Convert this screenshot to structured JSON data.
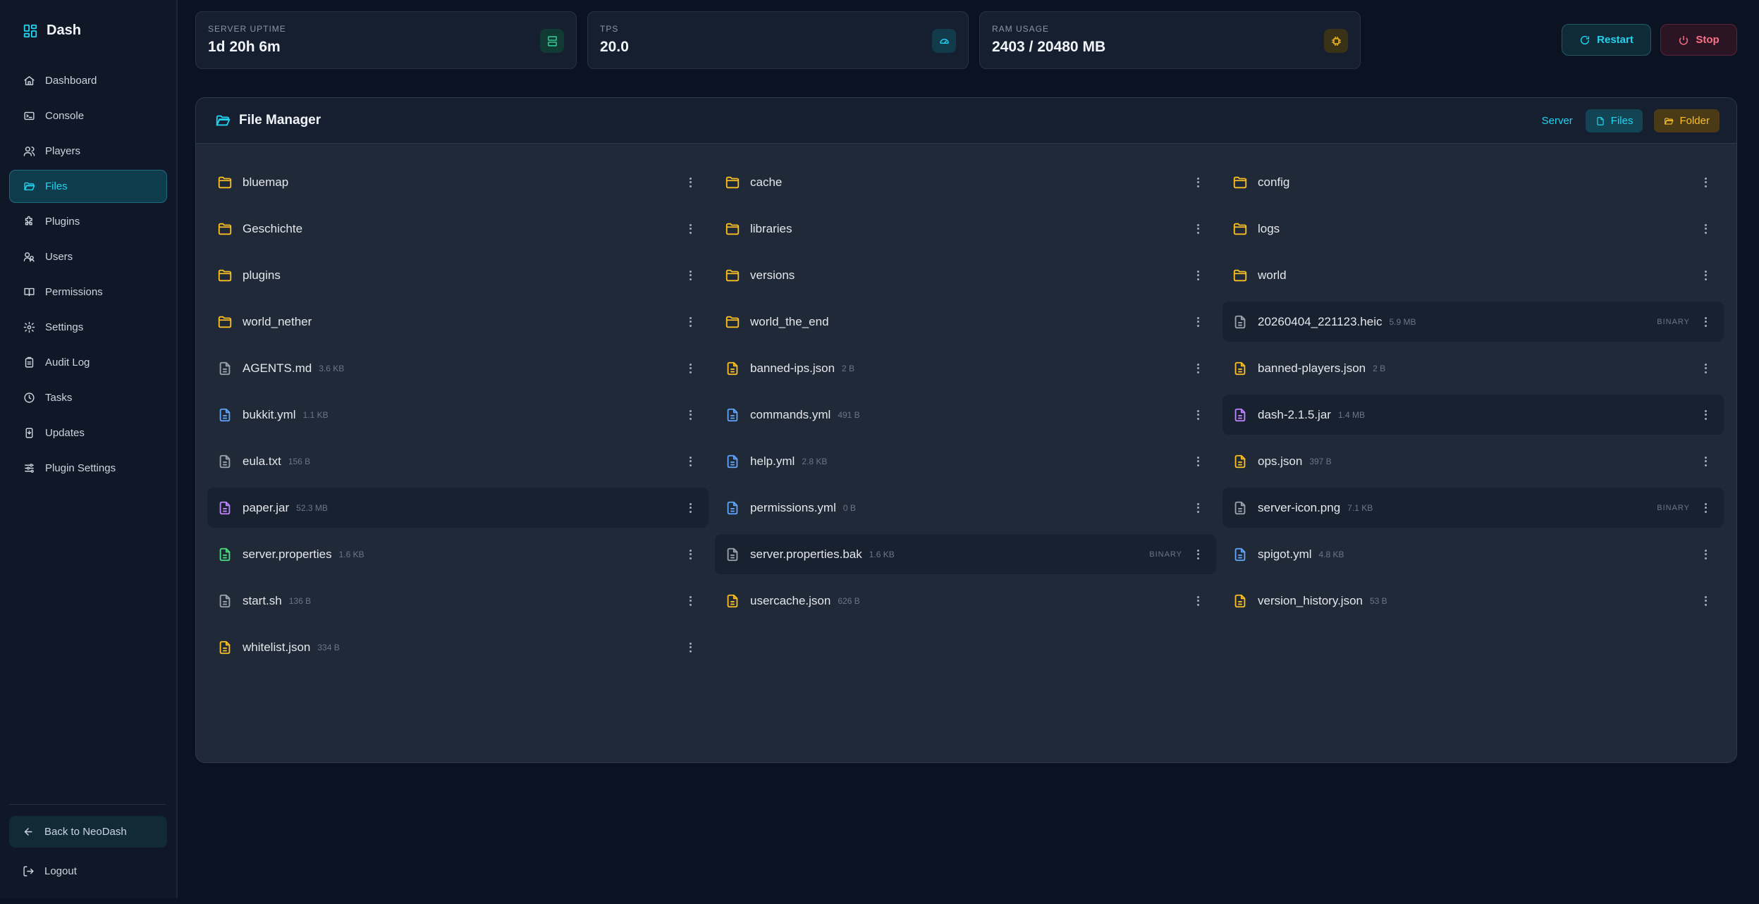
{
  "brand": {
    "name": "Dash"
  },
  "nav": [
    {
      "label": "Dashboard",
      "icon": "home-icon",
      "active": false
    },
    {
      "label": "Console",
      "icon": "terminal-icon",
      "active": false
    },
    {
      "label": "Players",
      "icon": "players-icon",
      "active": false
    },
    {
      "label": "Files",
      "icon": "folder-icon",
      "active": true
    },
    {
      "label": "Plugins",
      "icon": "puzzle-icon",
      "active": false
    },
    {
      "label": "Users",
      "icon": "users-icon",
      "active": false
    },
    {
      "label": "Permissions",
      "icon": "book-icon",
      "active": false
    },
    {
      "label": "Settings",
      "icon": "gear-icon",
      "active": false
    },
    {
      "label": "Audit Log",
      "icon": "clipboard-icon",
      "active": false
    },
    {
      "label": "Tasks",
      "icon": "clock-icon",
      "active": false
    },
    {
      "label": "Updates",
      "icon": "update-icon",
      "active": false
    },
    {
      "label": "Plugin Settings",
      "icon": "sliders-icon",
      "active": false
    }
  ],
  "sidebar_footer": {
    "back_label": "Back to NeoDash",
    "logout_label": "Logout"
  },
  "stats": [
    {
      "label": "SERVER UPTIME",
      "value": "1d 20h 6m",
      "icon": "server-icon",
      "color": "#34d399"
    },
    {
      "label": "TPS",
      "value": "20.0",
      "icon": "gauge-icon",
      "color": "#22d3ee"
    },
    {
      "label": "RAM USAGE",
      "value": "2403 / 20480 MB",
      "icon": "chip-icon",
      "color": "#fbbf24"
    }
  ],
  "actions": {
    "restart_label": "Restart",
    "stop_label": "Stop"
  },
  "file_manager": {
    "title": "File Manager",
    "server_link": "Server",
    "files_chip": "Files",
    "folder_chip": "Folder",
    "entries": [
      {
        "name": "bluemap",
        "kind": "folder",
        "size": "",
        "badge": "",
        "hl": false
      },
      {
        "name": "cache",
        "kind": "folder",
        "size": "",
        "badge": "",
        "hl": false
      },
      {
        "name": "config",
        "kind": "folder",
        "size": "",
        "badge": "",
        "hl": false
      },
      {
        "name": "Geschichte",
        "kind": "folder",
        "size": "",
        "badge": "",
        "hl": false
      },
      {
        "name": "libraries",
        "kind": "folder",
        "size": "",
        "badge": "",
        "hl": false
      },
      {
        "name": "logs",
        "kind": "folder",
        "size": "",
        "badge": "",
        "hl": false
      },
      {
        "name": "plugins",
        "kind": "folder",
        "size": "",
        "badge": "",
        "hl": false
      },
      {
        "name": "versions",
        "kind": "folder",
        "size": "",
        "badge": "",
        "hl": false
      },
      {
        "name": "world",
        "kind": "folder",
        "size": "",
        "badge": "",
        "hl": false
      },
      {
        "name": "world_nether",
        "kind": "folder",
        "size": "",
        "badge": "",
        "hl": false
      },
      {
        "name": "world_the_end",
        "kind": "folder",
        "size": "",
        "badge": "",
        "hl": false
      },
      {
        "name": "20260404_221123.heic",
        "kind": "file-gray",
        "size": "5.9 MB",
        "badge": "BINARY",
        "hl": true
      },
      {
        "name": "AGENTS.md",
        "kind": "file-gray",
        "size": "3.6 KB",
        "badge": "",
        "hl": false
      },
      {
        "name": "banned-ips.json",
        "kind": "file-yellow",
        "size": "2 B",
        "badge": "",
        "hl": false
      },
      {
        "name": "banned-players.json",
        "kind": "file-yellow",
        "size": "2 B",
        "badge": "",
        "hl": false
      },
      {
        "name": "bukkit.yml",
        "kind": "file-blue",
        "size": "1.1 KB",
        "badge": "",
        "hl": false
      },
      {
        "name": "commands.yml",
        "kind": "file-blue",
        "size": "491 B",
        "badge": "",
        "hl": false
      },
      {
        "name": "dash-2.1.5.jar",
        "kind": "file-purple",
        "size": "1.4 MB",
        "badge": "",
        "hl": true
      },
      {
        "name": "eula.txt",
        "kind": "file-gray",
        "size": "156 B",
        "badge": "",
        "hl": false
      },
      {
        "name": "help.yml",
        "kind": "file-blue",
        "size": "2.8 KB",
        "badge": "",
        "hl": false
      },
      {
        "name": "ops.json",
        "kind": "file-yellow",
        "size": "397 B",
        "badge": "",
        "hl": false
      },
      {
        "name": "paper.jar",
        "kind": "file-purple",
        "size": "52.3 MB",
        "badge": "",
        "hl": true
      },
      {
        "name": "permissions.yml",
        "kind": "file-blue",
        "size": "0 B",
        "badge": "",
        "hl": false
      },
      {
        "name": "server-icon.png",
        "kind": "file-gray",
        "size": "7.1 KB",
        "badge": "BINARY",
        "hl": true
      },
      {
        "name": "server.properties",
        "kind": "file-green",
        "size": "1.6 KB",
        "badge": "",
        "hl": false
      },
      {
        "name": "server.properties.bak",
        "kind": "file-gray",
        "size": "1.6 KB",
        "badge": "BINARY",
        "hl": true
      },
      {
        "name": "spigot.yml",
        "kind": "file-blue",
        "size": "4.8 KB",
        "badge": "",
        "hl": false
      },
      {
        "name": "start.sh",
        "kind": "file-gray",
        "size": "136 B",
        "badge": "",
        "hl": false
      },
      {
        "name": "usercache.json",
        "kind": "file-yellow",
        "size": "626 B",
        "badge": "",
        "hl": false
      },
      {
        "name": "version_history.json",
        "kind": "file-yellow",
        "size": "53 B",
        "badge": "",
        "hl": false
      },
      {
        "name": "whitelist.json",
        "kind": "file-yellow",
        "size": "334 B",
        "badge": "",
        "hl": false
      }
    ]
  },
  "colors": {
    "accent": "#22d3ee",
    "folder": "#fbbf24",
    "file_gray": "#9ca3af",
    "file_yellow": "#fbbf24",
    "file_blue": "#60a5fa",
    "file_purple": "#c084fc",
    "file_green": "#4ade80",
    "danger": "#fb7185"
  }
}
